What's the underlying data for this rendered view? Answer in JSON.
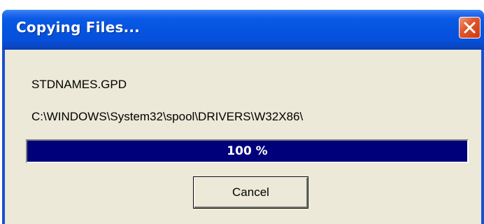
{
  "window": {
    "title": "Copying Files..."
  },
  "dialog": {
    "file_name": "STDNAMES.GPD",
    "file_path": "C:\\WINDOWS\\System32\\spool\\DRIVERS\\W32X86\\",
    "progress_label": "100 %",
    "progress_fraction": 1.0,
    "cancel_label": "Cancel"
  },
  "icons": {
    "close": "close-icon"
  },
  "colors": {
    "titlebar": "#0554e0",
    "close_button": "#e2582f",
    "client_background": "#ece9d8",
    "progress_fill": "#00007b",
    "progress_text": "#ffffff"
  }
}
